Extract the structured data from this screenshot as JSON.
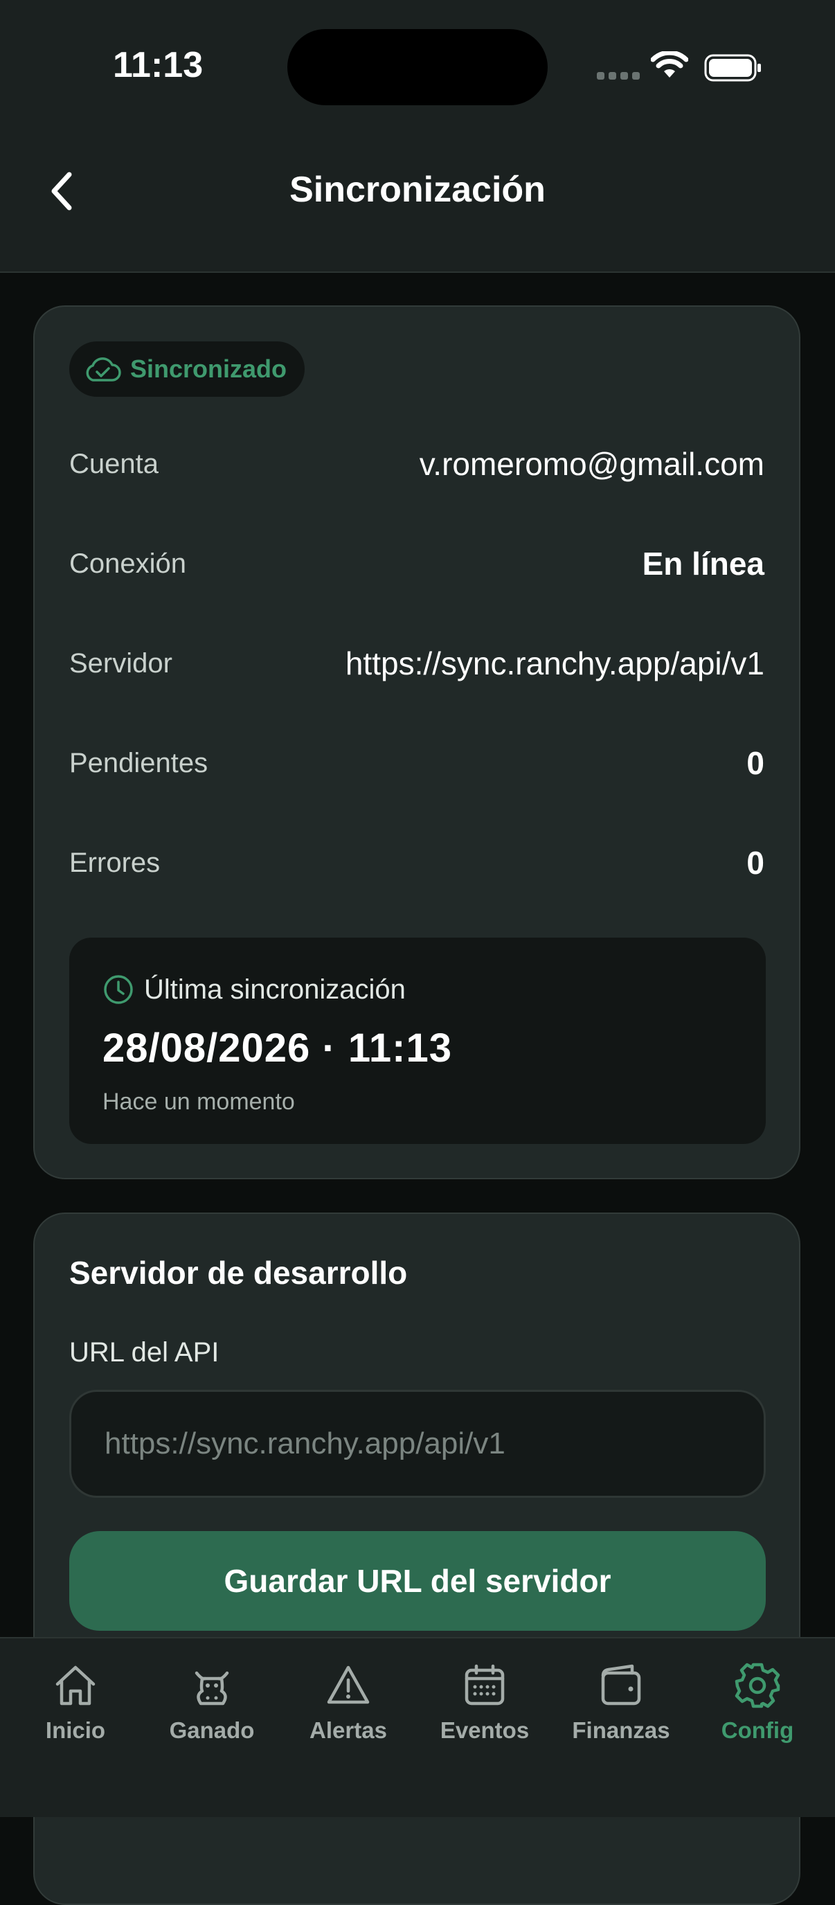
{
  "status_bar": {
    "time": "11:13"
  },
  "header": {
    "title": "Sincronización"
  },
  "sync_card": {
    "badge": "Sincronizado",
    "rows": [
      {
        "label": "Cuenta",
        "value": "v.romeromo@gmail.com"
      },
      {
        "label": "Conexión",
        "value": "En línea"
      },
      {
        "label": "Servidor",
        "value": "https://sync.ranchy.app/api/v1"
      },
      {
        "label": "Pendientes",
        "value": "0"
      },
      {
        "label": "Errores",
        "value": "0"
      }
    ],
    "last_sync": {
      "heading": "Última sincronización",
      "datetime": "28/08/2026 · 11:13",
      "relative": "Hace un momento"
    }
  },
  "dev_server": {
    "title": "Servidor de desarrollo",
    "field_label": "URL del API",
    "input_value": "",
    "input_placeholder": "https://sync.ranchy.app/api/v1",
    "save_label": "Guardar URL del servidor"
  },
  "tabs": [
    {
      "label": "Inicio",
      "icon": "home-icon"
    },
    {
      "label": "Ganado",
      "icon": "cow-icon"
    },
    {
      "label": "Alertas",
      "icon": "warning-icon"
    },
    {
      "label": "Eventos",
      "icon": "calendar-icon"
    },
    {
      "label": "Finanzas",
      "icon": "wallet-icon"
    },
    {
      "label": "Config",
      "icon": "gear-icon",
      "active": true
    }
  ],
  "colors": {
    "accent": "#3f9a6e",
    "button": "#2d6b50",
    "background": "#0b0e0d",
    "card": "#212928"
  }
}
